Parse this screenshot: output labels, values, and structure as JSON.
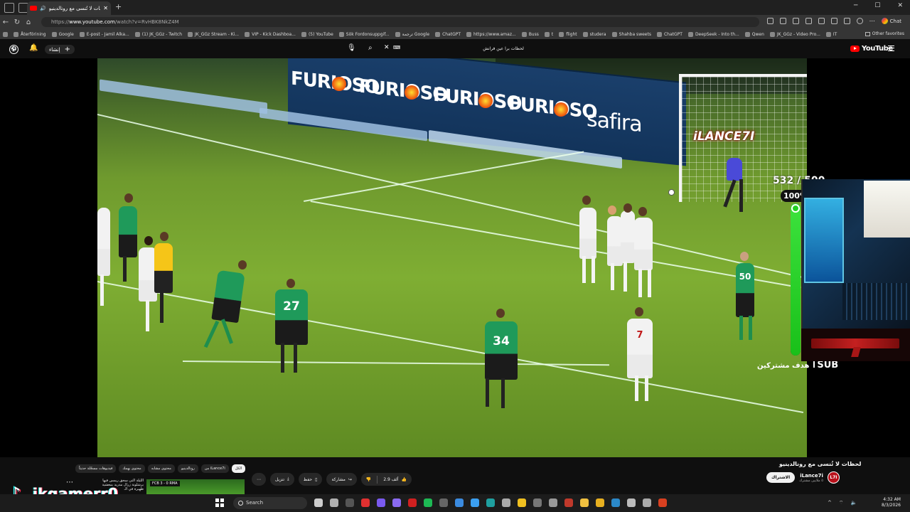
{
  "browser": {
    "tab_title": "لحظات لا تُنسى مع رونالدينيو -",
    "url_prefix": "https://",
    "url_domain": "www.youtube.com",
    "url_path": "/watch?v=RvHBK8NkZ4M",
    "chat_label": "Chat",
    "bookmarks": [
      "Återförining",
      "Google",
      "E-post - Jamil Alka...",
      "(1) JK_GGz - Twitch",
      "JK_GGz Stream - Ki...",
      "VIP - Kick Dashboa...",
      "(5) YouTube",
      "Sök Fordonsuppgif...",
      "ترجمة Google",
      "ChatGPT",
      "https://www.amaz...",
      "Buss",
      "t",
      "flight",
      "studera",
      "Shahba sweets",
      "ChatGPT",
      "DeepSeek - Into th...",
      "Qwen",
      "JK_GGz - Video Pro...",
      "IT"
    ],
    "other_favorites": "Other favorites"
  },
  "youtube": {
    "logo_text": "YouTube",
    "search_query": "لحظات برا عين فرانش",
    "create_label": "إنشاء",
    "video_title": "لحظات لا تُنسى مع رونالدينيو",
    "channel_name": "iLance7i",
    "channel_subs": "٥ ملايين مشترك",
    "channel_avatar_text": "L7I",
    "subscribe_label": "الاشتراك",
    "like_count": "2.9 ألف",
    "share_label": "مشاركة",
    "save_label": "حفظ",
    "download_label": "تنزيل",
    "chips": [
      "الكل",
      "من iLance7i",
      "رونالدينيو",
      "محتوى مشابه",
      "محتوى يهمك",
      "فيديوهات مسجّلة حديثاً"
    ],
    "rec_title": "الليلة التي سحق ريمس فيها برشلونة زرال مدريد بمعشية ظهيرة في الـ",
    "rec_score": "FCB 3 - 0 RMA"
  },
  "overlay": {
    "watermark": "iLANCE7I",
    "sub_count": "532 / 500",
    "sub_percent": "100%",
    "sub_progress": 1.0,
    "sub_word": "SUB",
    "sub_goal_text": "هدف مشتركين",
    "board_furioso": "FURIOSO",
    "board_safira": "safira",
    "jersey_numbers": [
      "27",
      "34",
      "7",
      "50"
    ],
    "tiktok_handle": "jkgamerr0"
  },
  "taskbar": {
    "search_label": "Search",
    "time": "4:32 AM",
    "date": "8/3/2026"
  },
  "colors": {
    "youtube_red": "#ff0000",
    "sub_bar_green": "#22d022",
    "pitch_green": "#7fae33"
  }
}
